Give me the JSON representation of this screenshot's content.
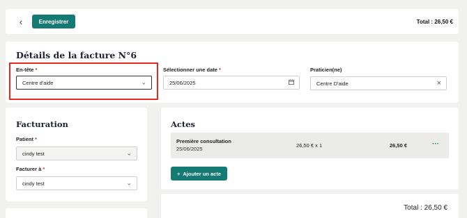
{
  "topbar": {
    "back_icon": "chevron-left-icon",
    "save_label": "Enregistrer",
    "total_text": "Total : 26,50 €"
  },
  "details": {
    "title": "Détails de la facture N°6",
    "header_field": {
      "label": "En-tête",
      "required_mark": "*",
      "value": "Centre d'aide"
    },
    "date_field": {
      "label": "Sélectionner une date",
      "required_mark": "*",
      "value": "25/06/2025"
    },
    "practitioner_field": {
      "label": "Praticien(ne)",
      "value": "Centre D'aide"
    }
  },
  "facturation": {
    "title": "Facturation",
    "patient_field": {
      "label": "Patient",
      "required_mark": "*",
      "value": "cindy test"
    },
    "bill_to_field": {
      "label": "Facturer à",
      "required_mark": "*",
      "value": "cindy test"
    }
  },
  "actes": {
    "title": "Actes",
    "items": [
      {
        "name": "Première consultation",
        "date": "25/06/2025",
        "qty_text": "26,50 € x 1",
        "price": "26,50 €"
      }
    ],
    "add_label": "Ajouter un acte",
    "total_text": "Total : 26,50 €"
  },
  "colors": {
    "accent": "#157a73",
    "highlight": "#e8291c"
  }
}
